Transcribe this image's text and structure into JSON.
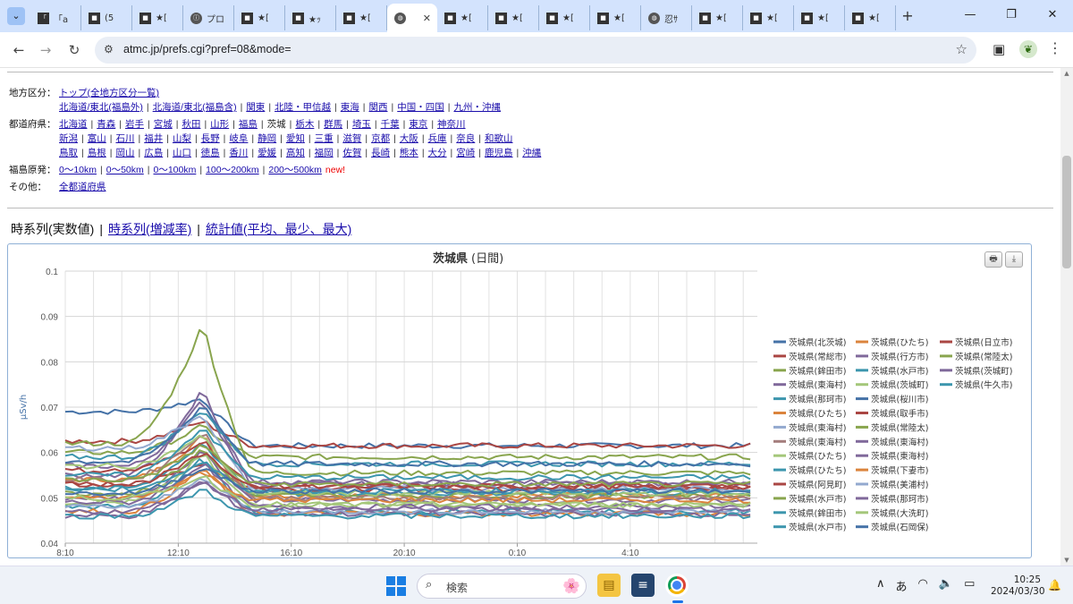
{
  "browser": {
    "tabs": [
      {
        "favicon": "「",
        "label": "「a"
      },
      {
        "favicon": "■",
        "label": "(5"
      },
      {
        "favicon": "■",
        "label": "★["
      },
      {
        "favicon": "ⓘ",
        "label": "プロ"
      },
      {
        "favicon": "■",
        "label": "★["
      },
      {
        "favicon": "■",
        "label": "★ｯ"
      },
      {
        "favicon": "■",
        "label": "★["
      },
      {
        "favicon": "◍",
        "label": "",
        "active": true,
        "close": "✕"
      },
      {
        "favicon": "■",
        "label": "★["
      },
      {
        "favicon": "■",
        "label": "★["
      },
      {
        "favicon": "■",
        "label": "★["
      },
      {
        "favicon": "■",
        "label": "★["
      },
      {
        "favicon": "◍",
        "label": "忍ｻ"
      },
      {
        "favicon": "■",
        "label": "★["
      },
      {
        "favicon": "■",
        "label": "★["
      },
      {
        "favicon": "■",
        "label": "★["
      },
      {
        "favicon": "■",
        "label": "★["
      }
    ],
    "new_tab": "+",
    "window_controls": {
      "minimize": "—",
      "restore": "❐",
      "close": "✕"
    },
    "nav": {
      "back": "←",
      "forward": "→",
      "reload": "↻"
    },
    "site_info": "⚙",
    "url": "atmc.jp/prefs.cgi?pref=08&mode=",
    "star": "☆",
    "side_panel": "▣",
    "extension": "❦",
    "menu": "⋮"
  },
  "page": {
    "rows": [
      {
        "label": "地方区分：",
        "lines": [
          [
            {
              "t": "トップ(全地方区分一覧)",
              "link": true
            }
          ],
          [
            {
              "t": "北海道/東北(福島外)",
              "link": true
            },
            {
              "t": "北海道/東北(福島含)",
              "link": true
            },
            {
              "t": "関東",
              "link": true
            },
            {
              "t": "北陸・甲信越",
              "link": true
            },
            {
              "t": "東海",
              "link": true
            },
            {
              "t": "関西",
              "link": true
            },
            {
              "t": "中国・四国",
              "link": true
            },
            {
              "t": "九州・沖縄",
              "link": true
            }
          ]
        ]
      },
      {
        "label": "都道府県：",
        "lines": [
          [
            {
              "t": "北海道",
              "link": true
            },
            {
              "t": "青森",
              "link": true
            },
            {
              "t": "岩手",
              "link": true
            },
            {
              "t": "宮城",
              "link": true
            },
            {
              "t": "秋田",
              "link": true
            },
            {
              "t": "山形",
              "link": true
            },
            {
              "t": "福島",
              "link": true
            },
            {
              "t": "茨城",
              "link": false
            },
            {
              "t": "栃木",
              "link": true
            },
            {
              "t": "群馬",
              "link": true
            },
            {
              "t": "埼玉",
              "link": true
            },
            {
              "t": "千葉",
              "link": true
            },
            {
              "t": "東京",
              "link": true
            },
            {
              "t": "神奈川",
              "link": true
            }
          ],
          [
            {
              "t": "新潟",
              "link": true
            },
            {
              "t": "富山",
              "link": true
            },
            {
              "t": "石川",
              "link": true
            },
            {
              "t": "福井",
              "link": true
            },
            {
              "t": "山梨",
              "link": true
            },
            {
              "t": "長野",
              "link": true
            },
            {
              "t": "岐阜",
              "link": true
            },
            {
              "t": "静岡",
              "link": true
            },
            {
              "t": "愛知",
              "link": true
            },
            {
              "t": "三重",
              "link": true
            },
            {
              "t": "滋賀",
              "link": true
            },
            {
              "t": "京都",
              "link": true
            },
            {
              "t": "大阪",
              "link": true
            },
            {
              "t": "兵庫",
              "link": true
            },
            {
              "t": "奈良",
              "link": true
            },
            {
              "t": "和歌山",
              "link": true
            }
          ],
          [
            {
              "t": "鳥取",
              "link": true
            },
            {
              "t": "島根",
              "link": true
            },
            {
              "t": "岡山",
              "link": true
            },
            {
              "t": "広島",
              "link": true
            },
            {
              "t": "山口",
              "link": true
            },
            {
              "t": "徳島",
              "link": true
            },
            {
              "t": "香川",
              "link": true
            },
            {
              "t": "愛媛",
              "link": true
            },
            {
              "t": "高知",
              "link": true
            },
            {
              "t": "福岡",
              "link": true
            },
            {
              "t": "佐賀",
              "link": true
            },
            {
              "t": "長崎",
              "link": true
            },
            {
              "t": "熊本",
              "link": true
            },
            {
              "t": "大分",
              "link": true
            },
            {
              "t": "宮崎",
              "link": true
            },
            {
              "t": "鹿児島",
              "link": true
            },
            {
              "t": "沖縄",
              "link": true
            }
          ]
        ]
      },
      {
        "label": "福島原発：",
        "lines": [
          [
            {
              "t": "0〜10km",
              "link": true
            },
            {
              "t": "0〜50km",
              "link": true
            },
            {
              "t": "0〜100km",
              "link": true
            },
            {
              "t": "100〜200km",
              "link": true
            },
            {
              "t": "200〜500km",
              "link": true
            }
          ]
        ],
        "new": "new!"
      },
      {
        "label": "その他：",
        "lines": [
          [
            {
              "t": "全都道府県",
              "link": true
            }
          ]
        ]
      }
    ],
    "view_tabs": {
      "current": "時系列(実数値)",
      "sep": "|",
      "link1": "時系列(増減率)",
      "link2": "統計値(平均、最少、最大)"
    },
    "export_buttons": {
      "print": "🖶",
      "download": "⤓"
    }
  },
  "chart_data": {
    "type": "line",
    "title": "茨城県",
    "subtitle": "(日間)",
    "ylabel": "μSv/h",
    "ylim": [
      0.04,
      0.1
    ],
    "yticks": [
      0.04,
      0.05,
      0.06,
      0.07,
      0.08,
      0.09,
      0.1
    ],
    "xrange": [
      0,
      24.5
    ],
    "xticks": [
      {
        "pos": 0,
        "label": "8:10"
      },
      {
        "pos": 4,
        "label": "12:10"
      },
      {
        "pos": 8,
        "label": "16:10"
      },
      {
        "pos": 12,
        "label": "20:10"
      },
      {
        "pos": 16,
        "label": "0:10"
      },
      {
        "pos": 20,
        "label": "4:10"
      }
    ],
    "grid": true,
    "legend_position": "right",
    "series": [
      {
        "name": "茨城県(北茨城)",
        "color": "#4572A7",
        "base": 0.069,
        "peak": 0.0,
        "post": 0.0615
      },
      {
        "name": "茨城県(ひたち)",
        "color": "#DB843D",
        "base": 0.054,
        "peak": 0.064,
        "post": 0.0505
      },
      {
        "name": "茨城県(日立市)",
        "color": "#AA4643",
        "base": 0.0625,
        "peak": 0.067,
        "post": 0.0615
      },
      {
        "name": "茨城県(常総市)",
        "color": "#AA4643",
        "base": 0.053,
        "peak": 0.058,
        "post": 0.052
      },
      {
        "name": "茨城県(行方市)",
        "color": "#80699B",
        "base": 0.05,
        "peak": 0.061,
        "post": 0.0495
      },
      {
        "name": "茨城県(常陸太)",
        "color": "#89A54E",
        "base": 0.06,
        "peak": 0.066,
        "post": 0.059
      },
      {
        "name": "茨城県(鉾田市)",
        "color": "#89A54E",
        "base": 0.062,
        "peak": 0.089,
        "post": 0.0555
      },
      {
        "name": "茨城県(水戸市)",
        "color": "#3D96AE",
        "base": 0.048,
        "peak": 0.059,
        "post": 0.047
      },
      {
        "name": "茨城県(茨城町)",
        "color": "#80699B",
        "base": 0.055,
        "peak": 0.0745,
        "post": 0.053
      },
      {
        "name": "茨城県(東海村)",
        "color": "#80699B",
        "base": 0.057,
        "peak": 0.072,
        "post": 0.0535
      },
      {
        "name": "茨城県(茨城町)",
        "color": "#A4C77A",
        "base": 0.049,
        "peak": 0.06,
        "post": 0.0485
      },
      {
        "name": "茨城県(牛久市)",
        "color": "#3D96AE",
        "base": 0.059,
        "peak": 0.07,
        "post": 0.0575
      },
      {
        "name": "茨城県(那珂市)",
        "color": "#3D96AE",
        "base": 0.052,
        "peak": 0.063,
        "post": 0.051
      },
      {
        "name": "茨城県(桜川市)",
        "color": "#4572A7",
        "base": 0.058,
        "peak": 0.071,
        "post": 0.0575
      },
      {
        "name": "茨城県(ひたち)",
        "color": "#DB843D",
        "base": 0.047,
        "peak": 0.057,
        "post": 0.0465
      },
      {
        "name": "茨城県(取手市)",
        "color": "#AA4643",
        "base": 0.056,
        "peak": 0.063,
        "post": 0.0525
      },
      {
        "name": "茨城県(東海村)",
        "color": "#93A9CF",
        "base": 0.061,
        "peak": 0.069,
        "post": 0.052
      },
      {
        "name": "茨城県(常陸太)",
        "color": "#89A54E",
        "base": 0.051,
        "peak": 0.061,
        "post": 0.0505
      },
      {
        "name": "茨城県(東海村)",
        "color": "#A47D7C",
        "base": 0.054,
        "peak": 0.065,
        "post": 0.05
      },
      {
        "name": "茨城県(東海村)",
        "color": "#80699B",
        "base": 0.049,
        "peak": 0.058,
        "post": 0.048
      },
      {
        "name": "茨城県(ひたち)",
        "color": "#A4C77A",
        "base": 0.057,
        "peak": 0.064,
        "post": 0.051
      },
      {
        "name": "茨城県(東海村)",
        "color": "#80699B",
        "base": 0.046,
        "peak": 0.054,
        "post": 0.0465
      },
      {
        "name": "茨城県(ひたち)",
        "color": "#3D96AE",
        "base": 0.055,
        "peak": 0.066,
        "post": 0.0545
      },
      {
        "name": "茨城県(下妻市)",
        "color": "#DB843D",
        "base": 0.05,
        "peak": 0.056,
        "post": 0.0495
      },
      {
        "name": "茨城県(阿見町)",
        "color": "#AA4643",
        "base": 0.053,
        "peak": 0.06,
        "post": 0.0525
      },
      {
        "name": "茨城県(美浦村)",
        "color": "#93A9CF",
        "base": 0.048,
        "peak": 0.055,
        "post": 0.047
      },
      {
        "name": "茨城県(水戸市)",
        "color": "#89A54E",
        "base": 0.054,
        "peak": 0.062,
        "post": 0.053
      },
      {
        "name": "茨城県(那珂市)",
        "color": "#80699B",
        "base": 0.047,
        "peak": 0.054,
        "post": 0.0475
      },
      {
        "name": "茨城県(鉾田市)",
        "color": "#3D96AE",
        "base": 0.052,
        "peak": 0.058,
        "post": 0.0515
      },
      {
        "name": "茨城県(大洗町)",
        "color": "#A4C77A",
        "base": 0.05,
        "peak": 0.055,
        "post": 0.0485
      },
      {
        "name": "茨城県(水戸市)",
        "color": "#3D96AE",
        "base": 0.046,
        "peak": 0.052,
        "post": 0.046
      },
      {
        "name": "茨城県(石岡保)",
        "color": "#4572A7",
        "base": 0.051,
        "peak": 0.057,
        "post": 0.0515
      }
    ]
  },
  "taskbar": {
    "search_icon": "⌕",
    "search_placeholder": "検索",
    "search_deco": "🌸",
    "files": "▤",
    "notepad": "≡",
    "tray_up": "∧",
    "ime": "あ",
    "wifi": "◠",
    "volume": "🔈",
    "battery": "▭",
    "time": "10:25",
    "date": "2024/03/30",
    "bell": "🔔"
  }
}
